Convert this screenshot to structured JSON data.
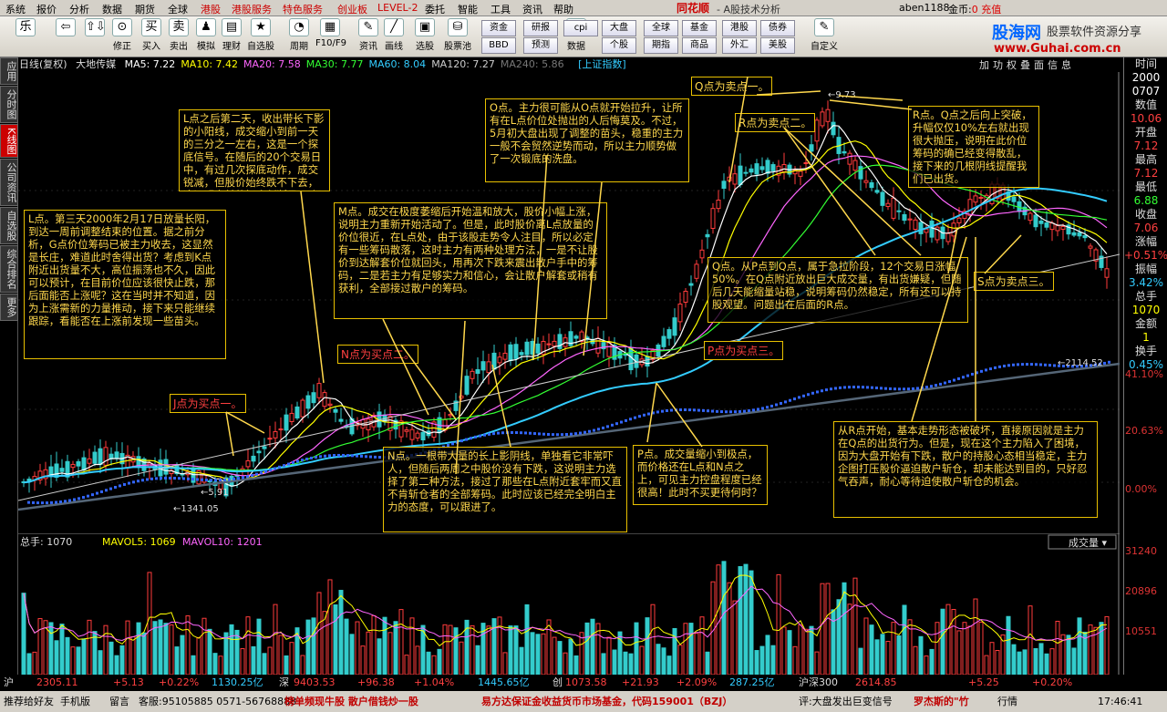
{
  "menubar": {
    "items": [
      "系统",
      "报价",
      "分析",
      "数据",
      "期货",
      "全球",
      "港股",
      "港股服务",
      "特色服务",
      "创业板",
      "LEVEL-2",
      "委托",
      "智能",
      "工具",
      "资讯",
      "帮助"
    ],
    "brand": "同花顺",
    "subtitle": "- A股技术分析",
    "user": "aben1188",
    "coin_label": "金币:",
    "coin_value": "0",
    "coin_action": "充值"
  },
  "toolbar": {
    "buttons": [
      {
        "label": "",
        "icon": "乐"
      },
      {
        "label": "",
        "icon": "⇦"
      },
      {
        "label": "",
        "icon": "⇧⇩"
      },
      {
        "label": "修正",
        "icon": "⊙"
      },
      {
        "label": "买入",
        "icon": "买"
      },
      {
        "label": "卖出",
        "icon": "卖"
      },
      {
        "label": "模拟",
        "icon": "♟"
      },
      {
        "label": "理财",
        "icon": "▤"
      },
      {
        "label": "自选股",
        "icon": "★"
      },
      {
        "label": "周期",
        "icon": "◔"
      },
      {
        "label": "F10/F9",
        "icon": "▦"
      },
      {
        "label": "资讯",
        "icon": "✎"
      },
      {
        "label": "画线",
        "icon": "╱"
      },
      {
        "label": "选股",
        "icon": "▣"
      },
      {
        "label": "股票池",
        "icon": "⛁"
      },
      {
        "label": "数据",
        "icon": "◉"
      }
    ],
    "small": [
      {
        "label": "资金",
        "row": 0
      },
      {
        "label": "BBD",
        "row": 1
      },
      {
        "label": "研报",
        "row": 0
      },
      {
        "label": "预测",
        "row": 1
      },
      {
        "label": "cpi",
        "row": 0
      },
      {
        "label": "大盘",
        "row": 0
      },
      {
        "label": "个股",
        "row": 1
      },
      {
        "label": "全球",
        "row": 0
      },
      {
        "label": "期指",
        "row": 1
      },
      {
        "label": "基金",
        "row": 0
      },
      {
        "label": "商品",
        "row": 1
      },
      {
        "label": "港股",
        "row": 0
      },
      {
        "label": "外汇",
        "row": 1
      },
      {
        "label": "债券",
        "row": 0
      },
      {
        "label": "美股",
        "row": 1
      }
    ],
    "custom_label": "自定义",
    "logo_site": "股海网",
    "logo_slogan": "股票软件资源分享",
    "logo_url": "www.Guhai.com.cn"
  },
  "sidetabs": [
    "应用",
    "分时图",
    "K线图",
    "公司资讯",
    "自选股",
    "综合排名",
    "更多"
  ],
  "indicators": {
    "period": "日线(复权)",
    "name": "大地传媒",
    "items": [
      {
        "label": "MA5: 7.22",
        "color": "#ffffff"
      },
      {
        "label": "MA10: 7.42",
        "color": "#ffff00"
      },
      {
        "label": "MA20: 7.58",
        "color": "#ff66ff"
      },
      {
        "label": "MA30: 7.77",
        "color": "#33ff33"
      },
      {
        "label": "MA60: 8.04",
        "color": "#33ccff"
      },
      {
        "label": "MA120: 7.27",
        "color": "#cccccc"
      },
      {
        "label": "MA240: 5.86",
        "color": "#777777"
      }
    ],
    "overlay": "[上证指数]"
  },
  "rtools": [
    "加",
    "功",
    "权",
    "叠",
    "面",
    "信",
    "息"
  ],
  "rightinfo": [
    {
      "label": "时间",
      "color": "#dddddd"
    },
    {
      "label": "2000",
      "color": "#ffffff"
    },
    {
      "label": "0707",
      "color": "#ffffff"
    },
    {
      "label": "数值",
      "color": "#dddddd"
    },
    {
      "label": "10.06",
      "color": "#ff4040"
    },
    {
      "label": "开盘",
      "color": "#dddddd"
    },
    {
      "label": "7.12",
      "color": "#ff4040"
    },
    {
      "label": "最高",
      "color": "#dddddd"
    },
    {
      "label": "7.12",
      "color": "#ff4040"
    },
    {
      "label": "最低",
      "color": "#dddddd"
    },
    {
      "label": "6.88",
      "color": "#33ff33"
    },
    {
      "label": "收盘",
      "color": "#dddddd"
    },
    {
      "label": "7.06",
      "color": "#ff4040"
    },
    {
      "label": "涨幅",
      "color": "#dddddd"
    },
    {
      "label": "+0.51%",
      "color": "#ff4040"
    },
    {
      "label": "振幅",
      "color": "#dddddd"
    },
    {
      "label": "3.42%",
      "color": "#33ccff"
    },
    {
      "label": "总手",
      "color": "#dddddd"
    },
    {
      "label": "1070",
      "color": "#ffff00"
    },
    {
      "label": "金额",
      "color": "#dddddd"
    },
    {
      "label": "1",
      "color": "#ffff00"
    },
    {
      "label": "换手",
      "color": "#dddddd"
    },
    {
      "label": "0.45%",
      "color": "#33ccff"
    }
  ],
  "price_axis": [
    "41.10%",
    "20.63%",
    "0.00%"
  ],
  "vol_axis": [
    "31240",
    "20896",
    "10551"
  ],
  "vol_header": {
    "total": "总手: 1070",
    "mavol5": "MAVOL5: 1069",
    "mavol10": "MAVOL10: 1201",
    "selector": "成交量"
  },
  "chart_labels": {
    "max_price": "9.73",
    "min_price": "1341.05",
    "low_mark": "5.91",
    "index_val": "2114.52"
  },
  "notes": [
    {
      "id": "note-l",
      "text": "L点。第三天2000年2月17日放量长阳，到达一周前调整结束的位置。据之前分析，G点价位筹码已被主力收去，这显然是长庄，难道此时舍得出货？考虑到K点附近出货量不大，高位振荡也不久，因此可以预计，在目前价位应该很快止跌，那后面能否上涨呢？这在当时并不知道，因为上涨需新的力量推动，接下来只能继续跟踪，看能否在上涨前发现一些苗头。"
    },
    {
      "id": "note-l2",
      "text": "L点之后第二天，收出带长下影的小阳线，成交缩小到前一天的三分之一左右，这是一个探底信号。在随后的20个交易日中，有过几次探底动作，成交锐减，但股价始终跌不下去，这证明之前的探底判断是正确的，底部已经找到。"
    },
    {
      "id": "note-m",
      "text": "M点。成交在极度萎缩后开始温和放大，股价小幅上涨，说明主力重新开始活动了。但是，此时股价离L点放量的价位很近，在L点处，由于该股走势令人注目，所以必定有一些筹码散落，这时主力有两种处理方法，一是不让股价到达解套价位就回头，用再次下跌来震出散户手中的筹码，二是若主力有足够实力和信心，会让散户解套或稍有获利，全部接过散户的筹码。"
    },
    {
      "id": "note-o",
      "text": "O点。主力很可能从O点就开始拉升，让所有在L点价位处抛出的人后悔莫及。不过，5月初大盘出现了调整的苗头，稳重的主力一般不会贸然逆势而动，所以主力顺势做了一次锻底的洗盘。"
    },
    {
      "id": "note-n",
      "text": "N点。一根带大量的长上影阴线，单独看它非常吓人，但随后两周之中股价没有下跌，这说明主力选择了第二种方法，接过了那些在L点附近套牢而又直不肯斩仓者的全部筹码。此时应该已经完全明白主力的态度，可以跟进了。"
    },
    {
      "id": "note-p",
      "text": "P点。成交量缩小到极点，而价格还在L点和N点之上，可见主力控盘程度已经很高！此时不买更待何时？"
    },
    {
      "id": "note-q",
      "text": "Q点。从P点到Q点，属于急拉阶段，12个交易日涨幅50%。在Q点附近放出巨大成交量，有出货嫌疑，但随后几天能缩量站稳，说明筹码仍然稳定，所有还可以持股观望。问题出在后面的R点。"
    },
    {
      "id": "note-r",
      "text": "R点。Q点之后向上突破，升幅仅仅10%左右就出现很大抛压，说明在此价位筹码的确已经变得散乱，接下来的几根阴线提醒我们已出货。"
    },
    {
      "id": "note-s",
      "text": "从R点开始，基本走势形态被破坏，直接原因就是主力在Q点的出货行为。但是，现在这个主力陷入了困境，因为大盘开始有下跌，散户的持股心态相当稳定，主力企图打压股价逼迫散户斩仓，却未能达到目的，只好忍气吞声，耐心等待迫使散户斩仓的机会。"
    }
  ],
  "labels": [
    {
      "id": "label-j",
      "text": "J点为买点一。"
    },
    {
      "id": "label-n",
      "text": "N点为买点二。"
    },
    {
      "id": "label-p",
      "text": "P点为买点三。"
    },
    {
      "id": "label-q",
      "text": "Q点为卖点一。"
    },
    {
      "id": "label-r",
      "text": "R点为卖点二。"
    },
    {
      "id": "label-s",
      "text": "S点为卖点三。"
    }
  ],
  "status1": [
    {
      "text": "沪",
      "color": "#dddddd"
    },
    {
      "text": "2305.11",
      "color": "#ff4040"
    },
    {
      "text": "+5.13",
      "color": "#ff4040"
    },
    {
      "text": "+0.22%",
      "color": "#ff4040"
    },
    {
      "text": "1130.25亿",
      "color": "#33ccff"
    },
    {
      "text": "深",
      "color": "#dddddd"
    },
    {
      "text": "9403.53",
      "color": "#ff4040"
    },
    {
      "text": "+96.38",
      "color": "#ff4040"
    },
    {
      "text": "+1.04%",
      "color": "#ff4040"
    },
    {
      "text": "1445.65亿",
      "color": "#33ccff"
    },
    {
      "text": "创",
      "color": "#dddddd"
    },
    {
      "text": "1073.58",
      "color": "#ff4040"
    },
    {
      "text": "+21.93",
      "color": "#ff4040"
    },
    {
      "text": "+2.09%",
      "color": "#ff4040"
    },
    {
      "text": "287.25亿",
      "color": "#33ccff"
    },
    {
      "text": "沪深300",
      "color": "#dddddd"
    },
    {
      "text": "2614.85",
      "color": "#ff4040"
    },
    {
      "text": "+5.25",
      "color": "#ff4040"
    },
    {
      "text": "+0.20%",
      "color": "#ff4040"
    }
  ],
  "status2": [
    {
      "text": "推荐给好友",
      "color": "#000000"
    },
    {
      "text": "手机版",
      "color": "#000000"
    },
    {
      "text": "留言",
      "color": "#000000"
    },
    {
      "text": "客服:95105885 0571-56768888",
      "color": "#000000"
    },
    {
      "text": "榜单频现牛股  散户借钱炒一股",
      "color": "#c00000"
    },
    {
      "text": "易方达保证金收益货币市场基金，代码159001（BZJ）",
      "color": "#c00000"
    },
    {
      "text": "评:大盘发出巨变信号",
      "color": "#000000"
    },
    {
      "text": "罗杰斯的\"竹",
      "color": "#c00000"
    },
    {
      "text": "行情",
      "color": "#000000"
    },
    {
      "text": "17:46:41",
      "color": "#000000"
    }
  ],
  "chart_data": {
    "type": "candlestick",
    "series": [
      {
        "name": "MA5",
        "values": []
      },
      {
        "name": "MA10",
        "values": []
      },
      {
        "name": "MA20",
        "values": []
      },
      {
        "name": "MA30",
        "values": []
      },
      {
        "name": "MA60",
        "values": []
      },
      {
        "name": "MA120",
        "values": []
      },
      {
        "name": "MA240",
        "values": []
      }
    ],
    "percent_ticks": [
      "41.10%",
      "20.63%",
      "0.00%"
    ],
    "volume_ticks": [
      31240,
      20896,
      10551
    ],
    "price_high": 9.73,
    "index_low": 1341.05,
    "index_last": 2114.52
  },
  "colors": {
    "up": "#ff3c3c",
    "down": "#33cccc",
    "annotation": "#ffd84d",
    "vol_up": "#ff3c3c",
    "vol_down": "#33cccc"
  }
}
